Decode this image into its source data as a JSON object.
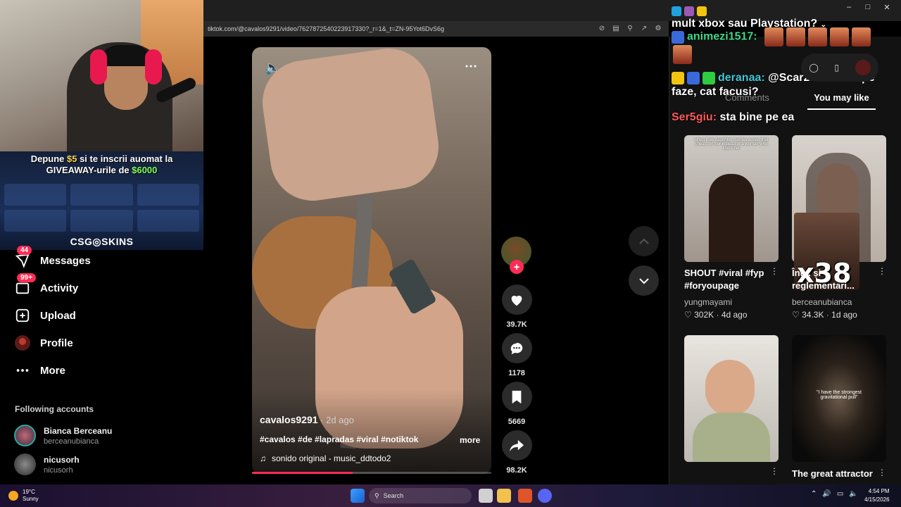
{
  "browser": {
    "url": "tiktok.com/@cavalos9291/video/7627872540223917330?_r=1&_t=ZN-95Yot6DvS6g",
    "window_title": "mult xbox sau Playstation?"
  },
  "promo": {
    "line1_pre": "Depune ",
    "line1_amount": "$5",
    "line1_post": " si te inscrii auomat la",
    "line2_pre": "GIVEAWAY-urile de ",
    "line2_amount": "$6000",
    "brand": "CSG◎SKINS"
  },
  "sidebar": {
    "items": [
      {
        "label": "Messages",
        "badge": "44",
        "icon": "paper-plane-icon"
      },
      {
        "label": "Activity",
        "badge": "99+",
        "icon": "inbox-icon"
      },
      {
        "label": "Upload",
        "badge": "",
        "icon": "plus-square-icon"
      },
      {
        "label": "Profile",
        "badge": "",
        "icon": "avatar-icon"
      },
      {
        "label": "More",
        "badge": "",
        "icon": "more-dots-icon"
      }
    ],
    "following_title": "Following accounts",
    "following": [
      {
        "name": "Bianca Berceanu",
        "handle": "berceanubianca"
      },
      {
        "name": "nicusorh",
        "handle": "nicusorh"
      }
    ]
  },
  "video": {
    "author": "cavalos9291",
    "ago": " · 2d ago",
    "caption": "#cavalos #de #lapradas #viral #notiktok",
    "more": "more",
    "music": "sonido original - music_ddtodo2",
    "progress": 0.42
  },
  "actions": {
    "likes": "39.7K",
    "comments": "1178",
    "saves": "5669",
    "shares": "98.2K"
  },
  "chat": {
    "title_line": "mult xbox sau Playstation?",
    "messages": [
      {
        "user": "animezi1517:",
        "text": ""
      },
      {
        "user": "deranaa:",
        "text": "@Scar222 uita te pe",
        "text2": "faze, cat facusi?"
      },
      {
        "user": "Ser5giu:",
        "text": "sta bine pe ea"
      }
    ]
  },
  "right": {
    "tab_comments": "Comments",
    "tab_you_may_like": "You may like",
    "cards": [
      {
        "title": "SHOUT #viral #fyp #foryoupage",
        "author": "yungmayami",
        "likes": "302K",
        "ago": "4d ago",
        "overlay": "when their daughter marries a man that cheats on her instead of a woman who loves her"
      },
      {
        "title": "Înt... și reglementari...",
        "author": "berceanubianca",
        "likes": "34.3K",
        "ago": "1d ago",
        "overlay": ""
      },
      {
        "title": "",
        "author": "",
        "likes": "",
        "ago": "",
        "overlay": ""
      },
      {
        "title": "The great attractor",
        "author": "",
        "likes": "",
        "ago": "",
        "overlay": "\"I have the strongest gravitational pull\""
      }
    ],
    "x38": "x38"
  },
  "taskbar": {
    "temp": "19°C",
    "weather": "Sunny",
    "search": "Search",
    "time": "4:54 PM",
    "date": "4/15/2026"
  },
  "colors": {
    "accent": "#fe2c55",
    "panel": "#121212"
  }
}
